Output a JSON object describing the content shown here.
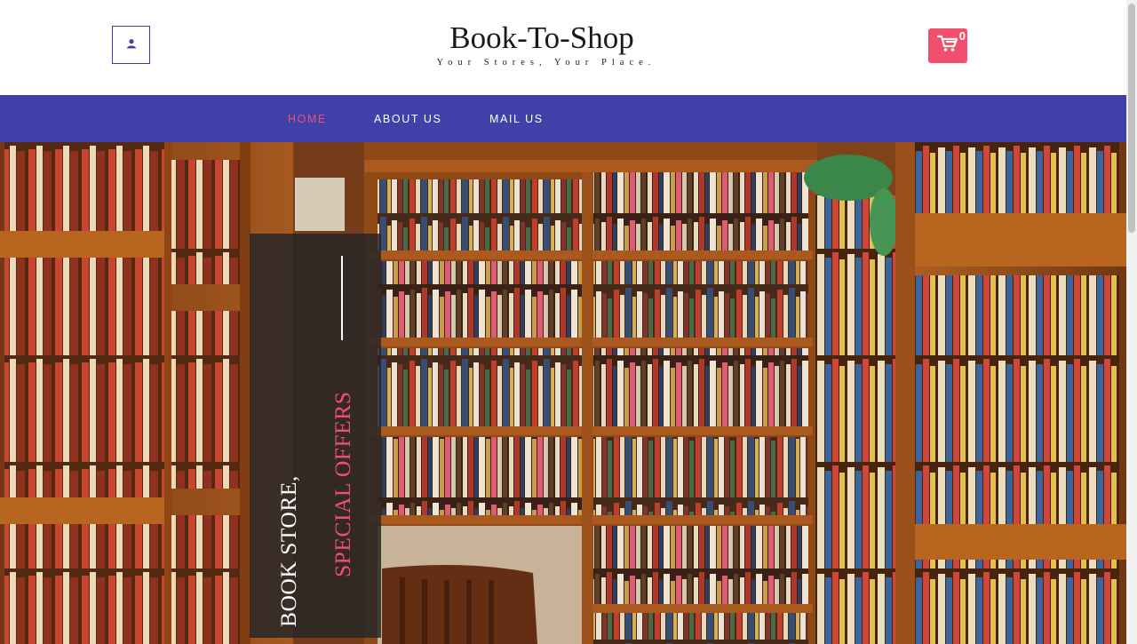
{
  "header": {
    "title": "Book-To-Shop",
    "tagline": "Your Stores, Your Place.",
    "account_icon": "user-icon",
    "cart_icon": "shopping-cart-icon",
    "cart_count": "0"
  },
  "nav": {
    "items": [
      {
        "label": "HOME",
        "active": true
      },
      {
        "label": "ABOUT US",
        "active": false
      },
      {
        "label": "MAIL US",
        "active": false
      }
    ]
  },
  "hero": {
    "image": "bookstore-shelves-photo",
    "line1": "BOOK STORE,",
    "line2": "SPECIAL OFFERS"
  },
  "colors": {
    "brand_blue": "#3f40a8",
    "accent_pink": "#f0506e",
    "panel_dark": "#282628"
  }
}
